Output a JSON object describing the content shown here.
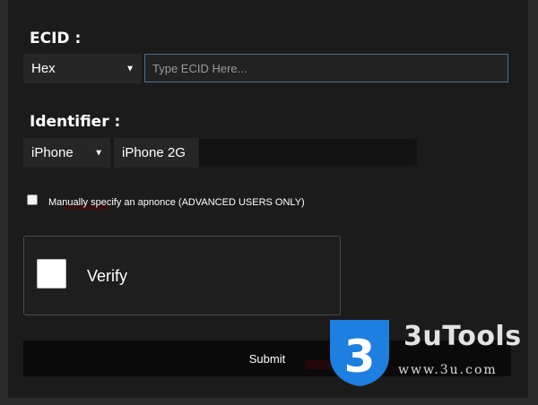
{
  "ecid": {
    "label": "ECID :",
    "format_selected": "Hex",
    "input_value": "",
    "input_placeholder": "Type ECID Here..."
  },
  "identifier": {
    "label": "Identifier :",
    "device_selected": "iPhone",
    "model_selected": "iPhone 2G"
  },
  "apnonce": {
    "checked": false,
    "label": "Manually specify an apnonce (ADVANCED USERS ONLY)"
  },
  "captcha": {
    "checked": false,
    "label": "Verify"
  },
  "submit": {
    "label": "Submit"
  },
  "watermark": {
    "logo_glyph": "3",
    "brand": "3uTools",
    "url": "www.3u.com",
    "logo_color": "#1d7fe0"
  },
  "icons": {
    "dropdown_caret": "▼"
  }
}
